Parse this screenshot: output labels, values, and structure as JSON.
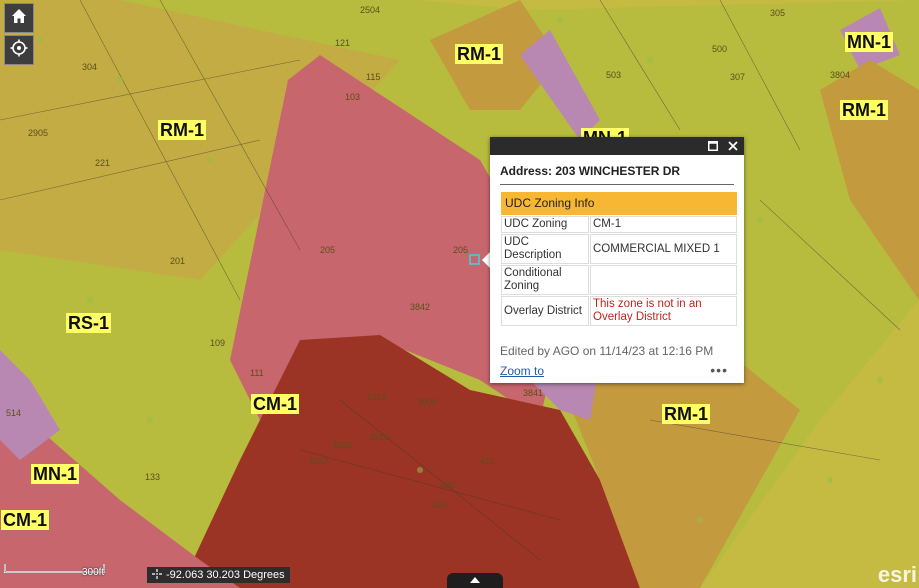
{
  "map": {
    "zone_labels": [
      "RM-1",
      "MN-1",
      "MN-1",
      "RM-1",
      "RM-1",
      "RS-1",
      "CM-1",
      "RM-1",
      "MN-1",
      "CM-1"
    ],
    "parcel_numbers": [
      "121",
      "103",
      "115",
      "2504",
      "304",
      "2905",
      "221",
      "201",
      "205",
      "111",
      "1013",
      "3900",
      "3916",
      "3920",
      "3922",
      "3842",
      "205",
      "109",
      "514",
      "133",
      "305",
      "3804",
      "307",
      "411",
      "409",
      "405",
      "503",
      "500",
      "3841"
    ],
    "colors": {
      "rm1": "#c9bd3c",
      "rs1": "#b8be3a",
      "cm1": "#c9656b",
      "mn1": "#b883b1",
      "cm_dark": "#9b3326"
    }
  },
  "controls": {
    "home_icon": "home-icon",
    "locate_icon": "locate-icon"
  },
  "popup": {
    "title": "Address: 203 WINCHESTER DR",
    "section_header": "UDC Zoning Info",
    "rows": [
      {
        "key": "UDC Zoning",
        "value": "CM-1"
      },
      {
        "key": "UDC Description",
        "value": "COMMERCIAL MIXED 1"
      },
      {
        "key": "Conditional Zoning",
        "value": ""
      },
      {
        "key": "Overlay District",
        "value": "This zone is not in an Overlay District"
      }
    ],
    "edited": "Edited by AGO on 11/14/23 at 12:16 PM",
    "zoom_link": "Zoom to",
    "more": "•••"
  },
  "scale_label": "300ft",
  "coordinates": "-92.063 30.203 Degrees",
  "attribution": "esri"
}
